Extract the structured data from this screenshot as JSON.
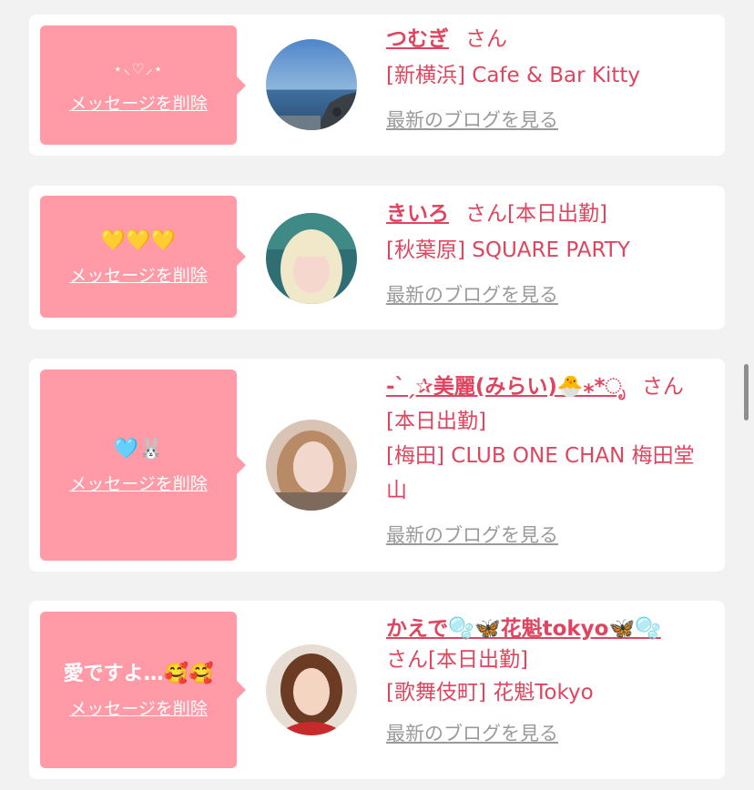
{
  "cards": [
    {
      "message": "⋆⸜♡⸝⋆",
      "delete_label": "メッセージを削除",
      "name": "つむぎ",
      "san": "さん",
      "status": "",
      "shop": "[新横浜] Cafe & Bar Kitty",
      "blog_label": "最新のブログを見る"
    },
    {
      "message": "💛💛💛",
      "delete_label": "メッセージを削除",
      "name": "きいろ",
      "san": "さん",
      "status": "[本日出勤]",
      "shop": "[秋葉原] SQUARE PARTY",
      "blog_label": "最新のブログを見る"
    },
    {
      "message": "🩵🐰",
      "delete_label": "メッセージを削除",
      "name": "-ˋˏ✰美麗(みらい)🐣⁎*ೃ",
      "san": "さん",
      "status": "[本日出勤]",
      "shop": "[梅田] CLUB ONE CHAN 梅田堂山",
      "blog_label": "最新のブログを見る"
    },
    {
      "message": "愛ですよ…🥰🥰",
      "delete_label": "メッセージを削除",
      "name": "かえで🫧🦋花魁tokyo🦋🫧",
      "san": "さん",
      "status": "[本日出勤]",
      "shop": "[歌舞伎町] 花魁Tokyo",
      "blog_label": "最新のブログを見る"
    }
  ],
  "colors": {
    "accent": "#e0455f",
    "bubble": "#ff9aa6",
    "link_gray": "#9a9a9a",
    "background": "#f2f2f2"
  }
}
